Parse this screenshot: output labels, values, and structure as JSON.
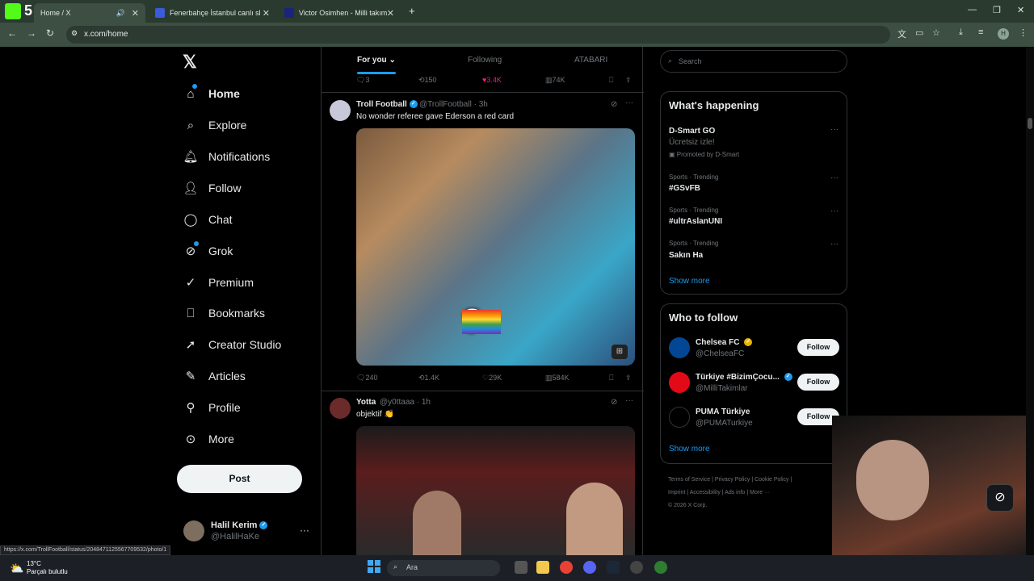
{
  "browser": {
    "tabs": [
      {
        "title": "Home / X"
      },
      {
        "title": "Fenerbahçe İstanbul canlı skoru"
      },
      {
        "title": "Victor Osimhen - Milli takım | T"
      }
    ],
    "url": "x.com/home",
    "profile_initial": "H"
  },
  "nav": {
    "items": [
      {
        "label": "Home"
      },
      {
        "label": "Explore"
      },
      {
        "label": "Notifications"
      },
      {
        "label": "Follow"
      },
      {
        "label": "Chat"
      },
      {
        "label": "Grok"
      },
      {
        "label": "Premium"
      },
      {
        "label": "Bookmarks"
      },
      {
        "label": "Creator Studio"
      },
      {
        "label": "Articles"
      },
      {
        "label": "Profile"
      },
      {
        "label": "More"
      }
    ],
    "post_label": "Post",
    "profile": {
      "name": "Halil Kerim",
      "handle": "@HalilHaKe"
    }
  },
  "feed": {
    "tabs": [
      {
        "label": "For you"
      },
      {
        "label": "Following"
      },
      {
        "label": "ATABARI"
      }
    ],
    "prev_actions": {
      "replies": "3",
      "reposts": "150",
      "likes": "3.4K",
      "views": "74K"
    },
    "tweets": [
      {
        "name": "Troll Football",
        "handle": "@TrollFootball",
        "time": "· 3h",
        "text": "No wonder referee gave Ederson a red card",
        "replies": "240",
        "reposts": "1.4K",
        "likes": "29K",
        "views": "584K"
      },
      {
        "name": "Yotta",
        "handle": "@y0ttaaa",
        "time": "· 1h",
        "text": "objektif 👏"
      }
    ]
  },
  "right": {
    "search_placeholder": "Search",
    "happening_title": "What's happening",
    "trends": [
      {
        "name": "D-Smart GO",
        "sub": "Ücretsiz izle!",
        "promo": "Promoted by D-Smart"
      },
      {
        "category": "Sports · Trending",
        "name": "#GSvFB"
      },
      {
        "category": "Sports · Trending",
        "name": "#ultrAslanUNI"
      },
      {
        "category": "Sports · Trending",
        "name": "Sakın Ha"
      }
    ],
    "show_more": "Show more",
    "wtf_title": "Who to follow",
    "wtf": [
      {
        "name": "Chelsea FC",
        "handle": "@ChelseaFC",
        "button": "Follow"
      },
      {
        "name": "Türkiye #BizimÇocu...",
        "handle": "@MilliTakimlar",
        "button": "Follow"
      },
      {
        "name": "PUMA Türkiye",
        "handle": "@PUMATurkiye",
        "button": "Follow"
      }
    ],
    "footer": {
      "line1": "Terms of Service  |  Privacy Policy  |  Cookie Policy  |",
      "line2": "Imprint  |  Accessibility  |  Ads info  |  More ···",
      "line3": "© 2026 X Corp."
    }
  },
  "status_url": "https://x.com/TrollFootball/status/2048471125567709532/photo/1",
  "taskbar": {
    "temp": "13°C",
    "weather": "Parçalı bulutlu",
    "search": "Ara"
  },
  "colors": {
    "accent": "#1d9bf0",
    "like": "#f91880",
    "bg": "#000000",
    "border": "#2f3336"
  }
}
